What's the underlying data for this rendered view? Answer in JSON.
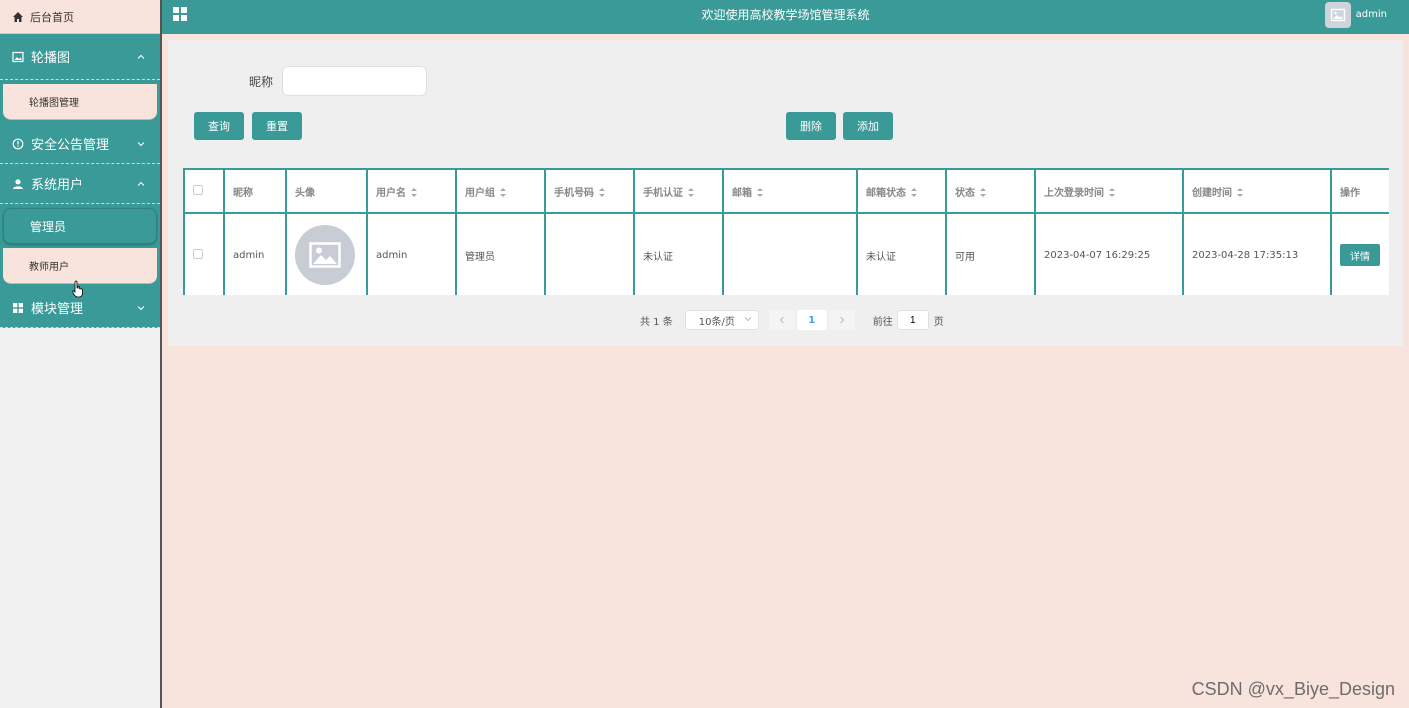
{
  "sidebar": {
    "home": "后台首页",
    "menus": [
      {
        "label": "轮播图",
        "items": [
          "轮播图管理"
        ]
      },
      {
        "label": "安全公告管理",
        "items": []
      },
      {
        "label": "系统用户",
        "items": [
          "管理员",
          "教师用户"
        ]
      },
      {
        "label": "模块管理",
        "items": []
      }
    ]
  },
  "topbar": {
    "title": "欢迎使用高校教学场馆管理系统",
    "user": "admin"
  },
  "search": {
    "label": "昵称",
    "value": ""
  },
  "buttons": {
    "query": "查询",
    "reset": "重置",
    "delete": "删除",
    "add": "添加"
  },
  "table": {
    "headers": [
      "昵称",
      "头像",
      "用户名",
      "用户组",
      "手机号码",
      "手机认证",
      "邮箱",
      "邮箱状态",
      "状态",
      "上次登录时间",
      "创建时间",
      "操作"
    ],
    "rows": [
      {
        "nickname": "admin",
        "username": "admin",
        "group": "管理员",
        "phone": "",
        "phone_auth": "未认证",
        "email": "",
        "email_status": "未认证",
        "status": "可用",
        "last_login": "2023-04-07 16:29:25",
        "created": "2023-04-28 17:35:13",
        "action": "详情"
      }
    ]
  },
  "pager": {
    "total": "共 1 条",
    "size": "10条/页",
    "page": "1",
    "goto": "前往",
    "jump": "1",
    "unit": "页"
  },
  "watermark": "CSDN @vx_Biye_Design",
  "colors": {
    "primary": "#3a9a98",
    "background": "#f8e4dc"
  }
}
